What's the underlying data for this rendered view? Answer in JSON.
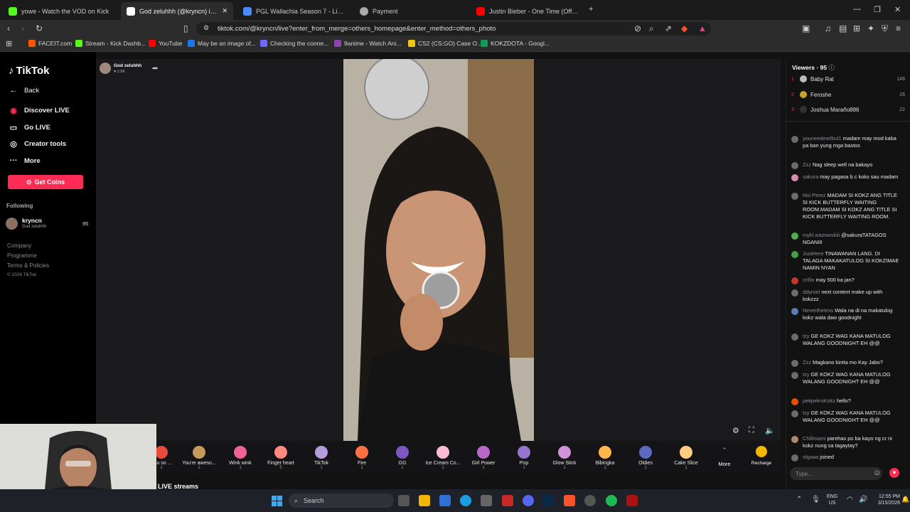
{
  "tabs": [
    {
      "title": "yowe - Watch the VOD on Kick",
      "color": "#53fc18"
    },
    {
      "title": "God zeluhhh (@kryncn) is LIVE",
      "color": "#ffffff"
    },
    {
      "title": "PGL Wallachia Season 7 - Liquipedia",
      "color": "#4a8cff"
    },
    {
      "title": "Payment",
      "color": "#aaaaaa"
    },
    {
      "title": "Justin Bieber - One Time (Official Mu...",
      "color": "#ff0000"
    }
  ],
  "url": "tiktok.com/@kryncn/live?enter_from_merge=others_homepage&enter_method=others_photo",
  "bookmarks": [
    {
      "label": "FACEIT.com",
      "color": "#ff5500"
    },
    {
      "label": "Stream - Kick Dashb...",
      "color": "#53fc18"
    },
    {
      "label": "YouTube",
      "color": "#ff0000"
    },
    {
      "label": "May be an image of...",
      "color": "#1877f2"
    },
    {
      "label": "Checking the conne...",
      "color": "#6b6bff"
    },
    {
      "label": "9anime - Watch Ani...",
      "color": "#8e44ad"
    },
    {
      "label": "CS2 (CS:GO) Case O...",
      "color": "#f1c40f"
    },
    {
      "label": "KOKZDOTA - Googl...",
      "color": "#0f9d58"
    }
  ],
  "sidebar": {
    "logo": "TikTok",
    "back": "Back",
    "items": [
      {
        "label": "Discover LIVE",
        "icon": "live-icon"
      },
      {
        "label": "Go LIVE",
        "icon": "camera-icon"
      },
      {
        "label": "Creator tools",
        "icon": "lightbulb-icon"
      },
      {
        "label": "More",
        "icon": "ellipsis-icon"
      }
    ],
    "get_coins": "Get Coins",
    "following_label": "Following",
    "following": [
      {
        "name": "kryncn",
        "sub": "God zeluhhh",
        "count": "95"
      }
    ],
    "footer": [
      "Company",
      "Programme",
      "Terms & Policies",
      "© 2026 TikTok"
    ]
  },
  "stream": {
    "host": "God zeluhhh",
    "likes": "2.8K",
    "section": "LIVE streams"
  },
  "gifts": [
    {
      "name": "You so ...",
      "cost": "1",
      "color": "#e74c3c"
    },
    {
      "name": "You're aweso...",
      "cost": "1",
      "color": "#c79a5b"
    },
    {
      "name": "Wink wink",
      "cost": "1",
      "color": "#f06292"
    },
    {
      "name": "Finger heart",
      "cost": "5",
      "color": "#ff8a80"
    },
    {
      "name": "TikTok",
      "cost": "1",
      "color": "#b39ddb"
    },
    {
      "name": "Fire",
      "cost": "1",
      "color": "#ff7043"
    },
    {
      "name": "GG",
      "cost": "1",
      "color": "#7e57c2"
    },
    {
      "name": "Ice Cream Co...",
      "cost": "1",
      "color": "#f8bbd0"
    },
    {
      "name": "Girl Power",
      "cost": "1",
      "color": "#ba68c8"
    },
    {
      "name": "Pop",
      "cost": "1",
      "color": "#9575cd"
    },
    {
      "name": "Glow Stick",
      "cost": "1",
      "color": "#ce93d8"
    },
    {
      "name": "Bibingka",
      "cost": "1",
      "color": "#ffb74d"
    },
    {
      "name": "Oldies",
      "cost": "1",
      "color": "#5c6bc0"
    },
    {
      "name": "Cake Slice",
      "cost": "1",
      "color": "#ffcc80"
    }
  ],
  "gift_more": "More",
  "recharge": "Recharge",
  "viewers": {
    "label": "Viewers · 95",
    "top": [
      {
        "rank": "1",
        "name": "Baby Rat",
        "count": "148"
      },
      {
        "rank": "2",
        "name": "Feroshe",
        "count": "26"
      },
      {
        "rank": "3",
        "name": "Joshua Maraño886",
        "count": "22"
      }
    ]
  },
  "chat": [
    {
      "user": "youneedearlbul1",
      "text": "madam may mod kaba pa ban yung mga bastos"
    },
    {
      "user": "Zzz",
      "text": "Nag sleep well na bakayo"
    },
    {
      "user": "sakura",
      "text": "may pagasa b c koks sau madam"
    },
    {
      "user": "Noi Perez",
      "text": "MADAM SI KOKZ ANG TITLE SI KICK BUTTERFLY WAITING ROOM.MADAM SI KOKZ ANG TITLE SI KICK BUTTERFLY WAITING ROOM."
    },
    {
      "user": "mykl.wazowskiii",
      "text": "@sakuraTATAGOS NGANIII"
    },
    {
      "user": "JustHere",
      "text": "TINAWANAN LANG. DI TALAGA MAKAKATULOG SI KOKZIMAE NAMIN NYAN"
    },
    {
      "user": "crillix",
      "text": "may 500 ka jan?"
    },
    {
      "user": "ddyroel",
      "text": "next content make up with kokzzz"
    },
    {
      "user": "Nevertheless",
      "text": "Wala na di na makatulog kokz wala daw goodnight"
    },
    {
      "user": "tzy",
      "text": "GE KOKZ WAG KANA MATULOG WALANG GOODNIGHT EH @@"
    },
    {
      "user": "Zzz",
      "text": "Magkano kinita mo Kay Jabo?"
    },
    {
      "user": "tzy",
      "text": "GE KOKZ WAG KANA MATULOG WALANG GOODNIGHT EH @@"
    },
    {
      "user": "pekpekniKokz",
      "text": "hello?"
    },
    {
      "user": "tzy",
      "text": "GE KOKZ WAG KANA MATULOG WALANG GOODNIGHT EH @@"
    },
    {
      "user": "Chillmami",
      "text": "parehas po ba kayo ng cr ni kokz nung sa tagaytay?"
    },
    {
      "user": "olgaaa",
      "text": "joined"
    }
  ],
  "chat_placeholder": "Type...",
  "taskbar": {
    "search": "Search",
    "lang1": "ENG",
    "lang2": "US",
    "time": "12:55 PM",
    "date": "3/15/2026"
  }
}
